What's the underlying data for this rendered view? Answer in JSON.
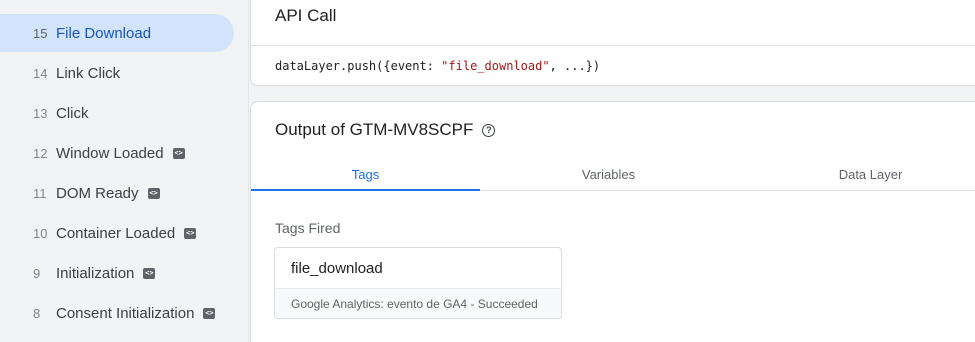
{
  "sidebar": {
    "events": [
      {
        "num": "15",
        "label": "File Download",
        "active": true,
        "has_code_icon": false
      },
      {
        "num": "14",
        "label": "Link Click",
        "active": false,
        "has_code_icon": false
      },
      {
        "num": "13",
        "label": "Click",
        "active": false,
        "has_code_icon": false
      },
      {
        "num": "12",
        "label": "Window Loaded",
        "active": false,
        "has_code_icon": true
      },
      {
        "num": "11",
        "label": "DOM Ready",
        "active": false,
        "has_code_icon": true
      },
      {
        "num": "10",
        "label": "Container Loaded",
        "active": false,
        "has_code_icon": true
      },
      {
        "num": "9",
        "label": "Initialization",
        "active": false,
        "has_code_icon": true
      },
      {
        "num": "8",
        "label": "Consent Initialization",
        "active": false,
        "has_code_icon": true
      }
    ],
    "code_icon_name": "code-icon"
  },
  "api_call": {
    "title": "API Call",
    "code_prefix": "dataLayer.push({event: ",
    "code_string": "\"file_download\"",
    "code_suffix": ", ...})"
  },
  "output": {
    "title": "Output of GTM-MV8SCPF",
    "help_icon": "help-icon",
    "tabs": [
      {
        "label": "Tags",
        "active": true
      },
      {
        "label": "Variables",
        "active": false
      },
      {
        "label": "Data Layer",
        "active": false
      }
    ],
    "tags_fired_label": "Tags Fired",
    "fired_tags": [
      {
        "name": "file_download",
        "status": "Google Analytics: evento de GA4 - Succeeded"
      }
    ]
  },
  "colors": {
    "accent": "#1a73e8",
    "active_item_bg": "#d2e3fc",
    "code_string": "#a31515"
  }
}
